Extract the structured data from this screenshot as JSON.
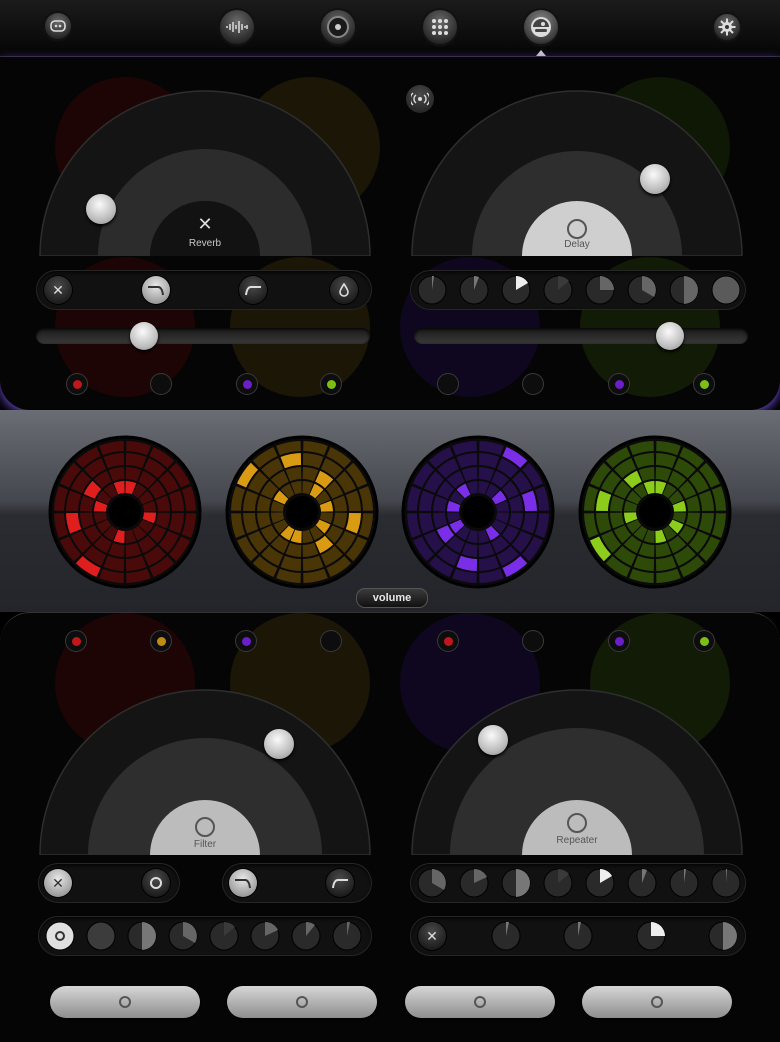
{
  "nav": {
    "items": [
      {
        "name": "back-icon",
        "icon": "face-icon"
      },
      {
        "name": "waveform-icon",
        "icon": "waveform-icon"
      },
      {
        "name": "record-icon",
        "icon": "disc-icon"
      },
      {
        "name": "grid-icon",
        "icon": "grid-icon"
      },
      {
        "name": "effects-icon",
        "icon": "effects-icon",
        "active": true
      },
      {
        "name": "settings-icon",
        "icon": "gear-icon"
      }
    ]
  },
  "effects": {
    "reverb": {
      "label": "Reverb",
      "level": 0.2
    },
    "delay": {
      "label": "Delay",
      "level": 0.75
    },
    "filter": {
      "label": "Filter",
      "level": 0.8
    },
    "repeater": {
      "label": "Repeater",
      "level": 0.25
    }
  },
  "sliders": {
    "reverb_mix": 0.33,
    "delay_mix": 0.77
  },
  "volume_label": "volume",
  "colors": {
    "red": "#e01e1e",
    "orange": "#d99a14",
    "purple": "#7a2ee8",
    "green": "#8ccc1a",
    "accent": "#7a4ee0"
  }
}
